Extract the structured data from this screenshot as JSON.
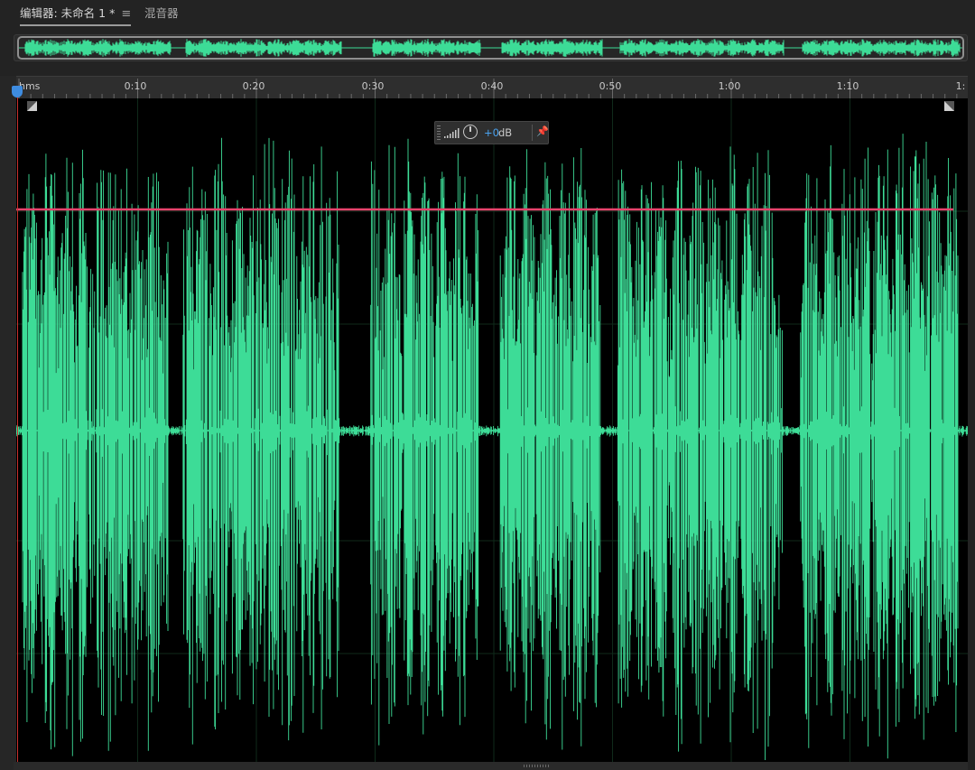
{
  "tabs": {
    "editor_label": "编辑器: 未命名 1 *",
    "editor_menu_icon": "hamburger-menu-icon",
    "mixer_label": "混音器"
  },
  "ruler": {
    "unit_label": "hms",
    "time_labels": [
      "0:10",
      "0:20",
      "0:30",
      "0:40",
      "0:50",
      "1:00",
      "1:10",
      "1:"
    ]
  },
  "hud": {
    "level_icon": "level-meter-icon",
    "knob_icon": "volume-knob-icon",
    "value": "+0",
    "unit": "dB",
    "pin_icon": "pin-icon"
  },
  "colors": {
    "waveform": "#3ddc97",
    "selection_line": "#e8436c",
    "playhead": "#3e8ce0",
    "background": "#000000"
  },
  "waveform": {
    "segments_seconds": [
      [
        0.3,
        12.6
      ],
      [
        13.8,
        27.0
      ],
      [
        29.6,
        38.7
      ],
      [
        40.5,
        49.0
      ],
      [
        50.4,
        64.3
      ],
      [
        65.8,
        79.1
      ]
    ],
    "duration_seconds": 79.1
  }
}
